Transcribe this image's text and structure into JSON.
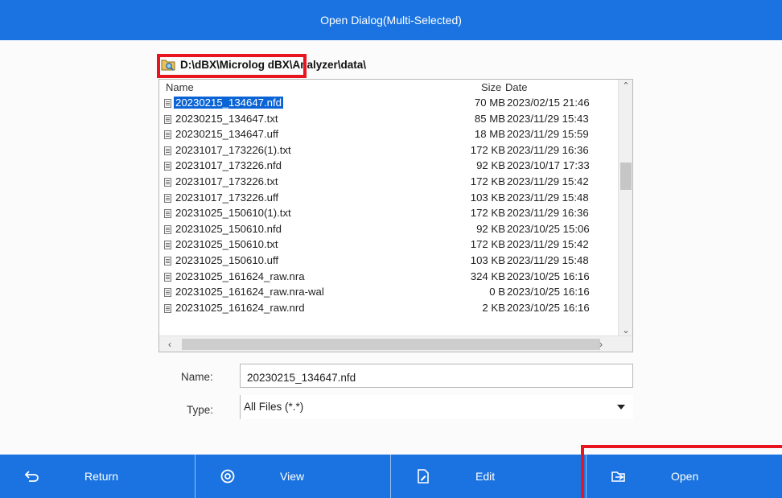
{
  "window": {
    "title": "Open Dialog(Multi-Selected)"
  },
  "path": {
    "text": "D:\\dBX\\Microlog dBX\\Analyzer\\data\\",
    "icon": "folder-search-icon"
  },
  "columns": {
    "name": "Name",
    "size": "Size",
    "date": "Date"
  },
  "files": [
    {
      "name": "20230215_134647.nfd",
      "size": "70 MB",
      "date": "2023/02/15 21:46",
      "selected": true
    },
    {
      "name": "20230215_134647.txt",
      "size": "85 MB",
      "date": "2023/11/29 15:43"
    },
    {
      "name": "20230215_134647.uff",
      "size": "18 MB",
      "date": "2023/11/29 15:59"
    },
    {
      "name": "20231017_173226(1).txt",
      "size": "172 KB",
      "date": "2023/11/29 16:36"
    },
    {
      "name": "20231017_173226.nfd",
      "size": "92 KB",
      "date": "2023/10/17 17:33"
    },
    {
      "name": "20231017_173226.txt",
      "size": "172 KB",
      "date": "2023/11/29 15:42"
    },
    {
      "name": "20231017_173226.uff",
      "size": "103 KB",
      "date": "2023/11/29 15:48"
    },
    {
      "name": "20231025_150610(1).txt",
      "size": "172 KB",
      "date": "2023/11/29 16:36"
    },
    {
      "name": "20231025_150610.nfd",
      "size": "92 KB",
      "date": "2023/10/25 15:06"
    },
    {
      "name": "20231025_150610.txt",
      "size": "172 KB",
      "date": "2023/11/29 15:42"
    },
    {
      "name": "20231025_150610.uff",
      "size": "103 KB",
      "date": "2023/11/29 15:48"
    },
    {
      "name": "20231025_161624_raw.nra",
      "size": "324 KB",
      "date": "2023/10/25 16:16"
    },
    {
      "name": "20231025_161624_raw.nra-wal",
      "size": "0 B",
      "date": "2023/10/25 16:16"
    },
    {
      "name": "20231025_161624_raw.nrd",
      "size": "2 KB",
      "date": "2023/10/25 16:16"
    }
  ],
  "form": {
    "name_label": "Name:",
    "name_value": "20230215_134647.nfd",
    "type_label": "Type:",
    "type_value": "All Files (*.*)"
  },
  "toolbar": {
    "return_label": "Return",
    "view_label": "View",
    "edit_label": "Edit",
    "open_label": "Open"
  },
  "colors": {
    "accent": "#1a73e0",
    "highlight": "#e8141e",
    "selection": "#0a64d6"
  }
}
